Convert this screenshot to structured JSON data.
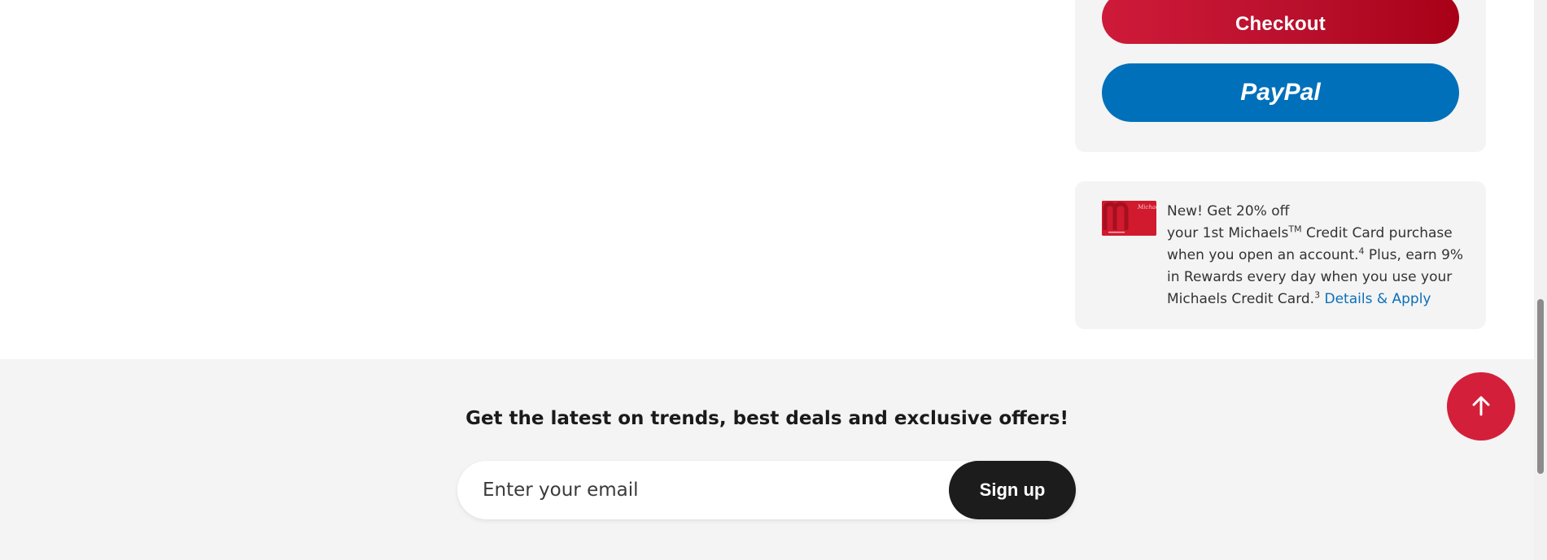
{
  "summary": {
    "checkout_label": "Checkout",
    "paypal_label": "PayPal"
  },
  "promo": {
    "line1": "New! Get 20% off",
    "line2_a": "your 1st Michaels",
    "line2_tm": "TM",
    "line2_b": " Credit Card purchase",
    "line3_a": "when you open an account.",
    "sup4": "4",
    "line3_b": " Plus, earn 9%",
    "line4": "in Rewards every day when you use your",
    "line5_a": "Michaels Credit Card.",
    "sup3": "3",
    "link": "Details & Apply",
    "card_brand": "Michaels"
  },
  "newsletter": {
    "heading": "Get the latest on trends, best deals and exclusive offers!",
    "email_placeholder": "Enter your email",
    "signup_label": "Sign up"
  },
  "colors": {
    "checkout_red": "#c8102e",
    "paypal_blue": "#0070ba",
    "back_to_top_red": "#d41f3a",
    "link_blue": "#0b6fb8",
    "signup_black": "#1c1c1c",
    "panel_gray": "#f4f4f4"
  },
  "icons": {
    "back_to_top": "arrow-up-icon",
    "card": "michaels-credit-card-icon"
  }
}
